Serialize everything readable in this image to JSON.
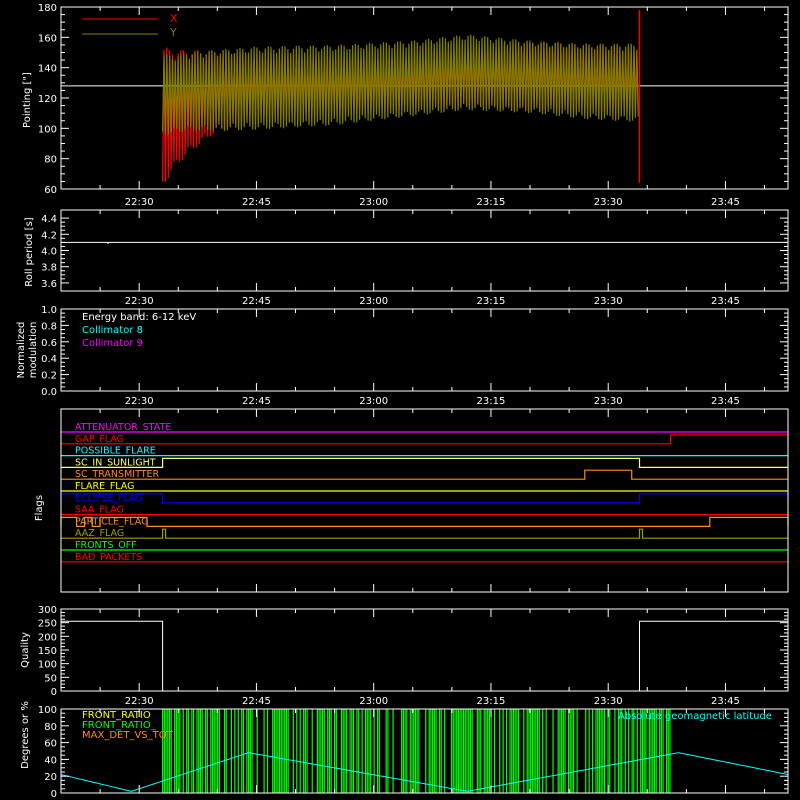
{
  "time_ticks": [
    "22:30",
    "22:45",
    "23:00",
    "23:15",
    "23:30",
    "23:45"
  ],
  "colors": {
    "x_red": "#ff0000",
    "y_olive": "#808000",
    "white": "#ffffff",
    "cyan": "#00ffff",
    "magenta": "#ff00ff",
    "green": "#00ff00",
    "orange": "#ff8c1a"
  },
  "chart_data": [
    {
      "type": "line",
      "title": "",
      "ylabel": "Pointing [\"]",
      "ylim": [
        60,
        180
      ],
      "y_ticks": [
        "60",
        "80",
        "100",
        "120",
        "140",
        "160",
        "180"
      ],
      "xlim": [
        "22:20",
        "23:53"
      ],
      "legend_placement": "top-left",
      "series": [
        {
          "name": "X",
          "color": "#ff0000",
          "x": [
            "22:33",
            "22:34",
            "22:36",
            "22:40",
            "22:45",
            "22:55",
            "23:05",
            "23:12",
            "23:20",
            "23:27",
            "23:34"
          ],
          "upper": [
            155,
            152,
            152,
            151,
            150,
            148,
            150,
            154,
            157,
            155,
            154
          ],
          "lower": [
            60,
            70,
            82,
            98,
            104,
            108,
            112,
            114,
            112,
            110,
            110
          ]
        },
        {
          "name": "Y",
          "color": "#808000",
          "x": [
            "22:33",
            "22:34",
            "22:36",
            "22:40",
            "22:45",
            "22:55",
            "23:05",
            "23:12",
            "23:20",
            "23:27",
            "23:34"
          ],
          "upper": [
            150,
            148,
            150,
            152,
            154,
            155,
            158,
            162,
            158,
            156,
            156
          ],
          "lower": [
            95,
            96,
            98,
            98,
            99,
            102,
            108,
            112,
            110,
            106,
            104
          ]
        },
        {
          "name": "",
          "color": "#ffffff",
          "x": [
            "22:20",
            "23:53"
          ],
          "y": [
            128,
            128
          ]
        }
      ]
    },
    {
      "type": "line",
      "title": "",
      "ylabel": "Roll period [s]",
      "ylim": [
        3.5,
        4.5
      ],
      "y_ticks": [
        "3.6",
        "3.8",
        "4.0",
        "4.2",
        "4.4"
      ],
      "series": [
        {
          "name": "",
          "color": "#ffffff",
          "x": [
            "22:20",
            "22:26",
            "22:26",
            "22:26",
            "23:53"
          ],
          "y": [
            4.1,
            4.1,
            4.08,
            4.1,
            4.1
          ]
        }
      ]
    },
    {
      "type": "line",
      "title": "",
      "ylabel_lines": [
        "Normalized",
        "modulation"
      ],
      "ylim": [
        0,
        1
      ],
      "y_ticks": [
        "0.0",
        "0.2",
        "0.4",
        "0.6",
        "0.8",
        "1.0"
      ],
      "legend_placement": "top-left",
      "legend": [
        {
          "label": "Energy band: 6-12 keV",
          "color": "#ffffff"
        },
        {
          "label": "Collimator 8",
          "color": "#00ffff"
        },
        {
          "label": "Collimator 9",
          "color": "#ff00ff"
        }
      ],
      "series": [
        {
          "name": "Collimator 9",
          "color": "#ff00ff",
          "x": [
            "22:20",
            "23:53"
          ],
          "y": [
            0,
            0
          ]
        }
      ]
    },
    {
      "type": "line",
      "title": "",
      "ylabel": "Flags",
      "flags": [
        {
          "label": "ATTENUATOR_STATE",
          "color": "#ff00ff",
          "steps": []
        },
        {
          "label": "GAP_FLAG",
          "color": "#ff0000",
          "steps": [
            [
              "23:38",
              "23:53"
            ]
          ]
        },
        {
          "label": "POSSIBLE_FLARE",
          "color": "#00ffff",
          "steps": []
        },
        {
          "label": "SC_IN_SUNLIGHT",
          "color": "#ffff66",
          "steps": [
            [
              "22:33",
              "23:34"
            ]
          ]
        },
        {
          "label": "SC_TRANSMITTER",
          "color": "#ff8c1a",
          "steps": [
            [
              "23:27",
              "23:33"
            ]
          ]
        },
        {
          "label": "FLARE_FLAG",
          "color": "#ffff00",
          "steps": []
        },
        {
          "label": "ECLIPSE_FLAG",
          "color": "#0000ff",
          "steps": [
            [
              "22:20",
              "22:33"
            ],
            [
              "23:34",
              "23:53"
            ]
          ]
        },
        {
          "label": "SAA_FLAG",
          "color": "#ff0000",
          "steps": []
        },
        {
          "label": "PARTICLE_FLAG",
          "color": "#ff8c1a",
          "steps": [
            [
              "22:20",
              "22:22"
            ],
            [
              "22:23",
              "22:24"
            ],
            [
              "22:25",
              "22:31"
            ],
            [
              "23:43",
              "23:53"
            ]
          ]
        },
        {
          "label": "AAZ_FLAG",
          "color": "#a0a000",
          "steps": [
            [
              "22:33",
              "22:33"
            ],
            [
              "23:34",
              "23:34"
            ]
          ]
        },
        {
          "label": "FRONTS_OFF",
          "color": "#00ff00",
          "steps": []
        },
        {
          "label": "BAD_PACKETS",
          "color": "#ff0000",
          "steps": []
        }
      ]
    },
    {
      "type": "line",
      "title": "",
      "ylabel": "Quality",
      "ylim": [
        0,
        300
      ],
      "y_ticks": [
        "0",
        "50",
        "100",
        "150",
        "200",
        "250",
        "300"
      ],
      "series": [
        {
          "name": "",
          "color": "#ffffff",
          "x": [
            "22:20",
            "22:33",
            "22:33",
            "23:34",
            "23:34",
            "23:53"
          ],
          "y": [
            255,
            255,
            0,
            0,
            255,
            255
          ]
        }
      ]
    },
    {
      "type": "line",
      "title": "",
      "ylabel": "Degrees or %",
      "ylim": [
        0,
        100
      ],
      "y_ticks": [
        "0",
        "20",
        "40",
        "60",
        "80",
        "100"
      ],
      "legend_placement": "top",
      "legend": [
        {
          "label": "FRONT_RATIO",
          "color": "#ffff00"
        },
        {
          "label": "FRONT_RATIO_",
          "color": "#00ff00"
        },
        {
          "label": "MAX_DET_VS_TOT",
          "color": "#ff8c1a"
        },
        {
          "label": "Absolute geomagnetic latitude",
          "color": "#00ffff"
        }
      ],
      "series": [
        {
          "name": "Absolute geomagnetic latitude",
          "color": "#00ffff",
          "x": [
            "22:20",
            "22:29",
            "22:44",
            "23:12",
            "23:39",
            "23:53"
          ],
          "y": [
            22,
            2,
            48,
            2,
            48,
            22
          ]
        },
        {
          "name": "FRONT_RATIO_",
          "color": "#00ff00",
          "x_range": [
            "22:33",
            "23:38"
          ],
          "y_range": [
            0,
            100
          ]
        }
      ]
    }
  ]
}
